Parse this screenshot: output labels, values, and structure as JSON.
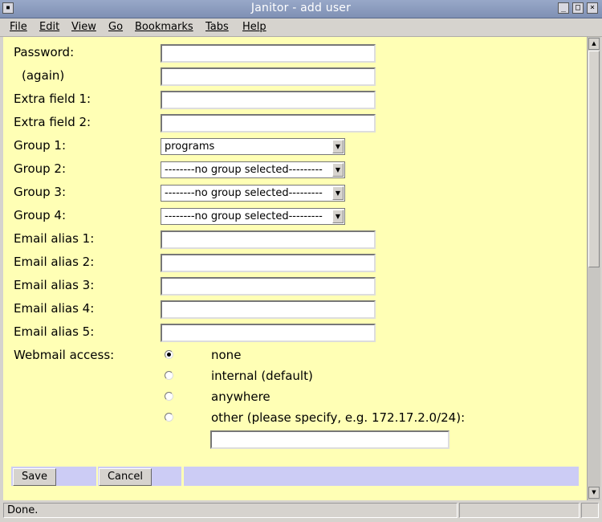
{
  "window": {
    "title": "Janitor - add user"
  },
  "menu": [
    "File",
    "Edit",
    "View",
    "Go",
    "Bookmarks",
    "Tabs",
    "Help"
  ],
  "form": {
    "text_fields": [
      {
        "label": "Password:",
        "value": ""
      },
      {
        "label": "(again)",
        "value": ""
      },
      {
        "label": "Extra field 1:",
        "value": ""
      },
      {
        "label": "Extra field 2:",
        "value": ""
      }
    ],
    "groups": [
      {
        "label": "Group 1:",
        "selected": "programs"
      },
      {
        "label": "Group 2:",
        "selected": "--------no group selected---------"
      },
      {
        "label": "Group 3:",
        "selected": "--------no group selected---------"
      },
      {
        "label": "Group 4:",
        "selected": "--------no group selected---------"
      }
    ],
    "email_aliases": [
      {
        "label": "Email alias 1:",
        "value": ""
      },
      {
        "label": "Email alias 2:",
        "value": ""
      },
      {
        "label": "Email alias 3:",
        "value": ""
      },
      {
        "label": "Email alias 4:",
        "value": ""
      },
      {
        "label": "Email alias 5:",
        "value": ""
      }
    ],
    "webmail": {
      "label": "Webmail access:",
      "options": [
        {
          "label": "none",
          "checked": true
        },
        {
          "label": "internal (default)",
          "checked": false
        },
        {
          "label": "anywhere",
          "checked": false
        },
        {
          "label": "other (please specify, e.g. 172.17.2.0/24):",
          "checked": false
        }
      ],
      "other_value": ""
    },
    "buttons": {
      "save": "Save",
      "cancel": "Cancel"
    }
  },
  "status": {
    "text": "Done."
  },
  "colors": {
    "page_background": "#ffffb5",
    "button_bar": "#ccccf5"
  }
}
